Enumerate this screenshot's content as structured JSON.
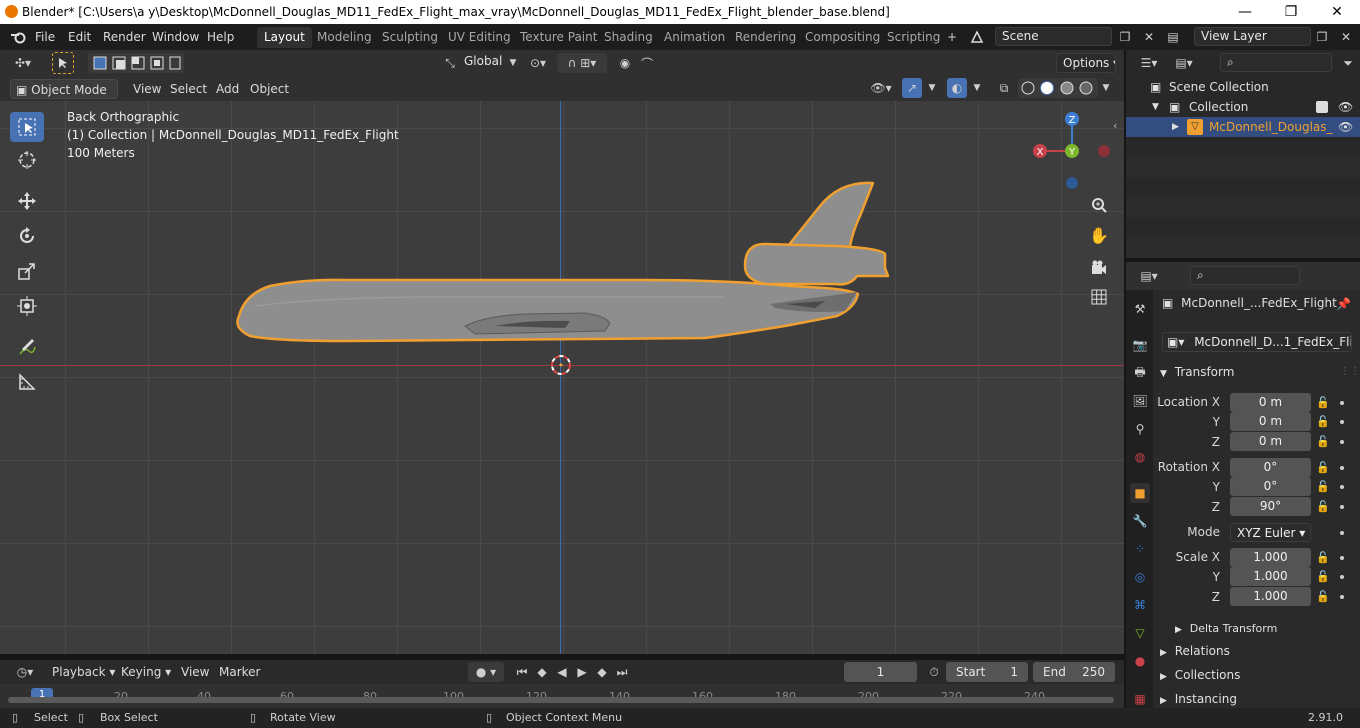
{
  "window": {
    "title": "Blender* [C:\\Users\\a y\\Desktop\\McDonnell_Douglas_MD11_FedEx_Flight_max_vray\\McDonnell_Douglas_MD11_FedEx_Flight_blender_base.blend]",
    "minimize": "—",
    "maximize": "❐",
    "close": "✕"
  },
  "menu": [
    "File",
    "Edit",
    "Render",
    "Window",
    "Help"
  ],
  "workspaces": [
    "Layout",
    "Modeling",
    "Sculpting",
    "UV Editing",
    "Texture Paint",
    "Shading",
    "Animation",
    "Rendering",
    "Compositing",
    "Scripting"
  ],
  "active_workspace": "Layout",
  "scene": {
    "name": "Scene",
    "view_layer": "View Layer"
  },
  "toolbar": {
    "orientation": "Global",
    "options": "Options"
  },
  "viewport_header": {
    "mode": "Object Mode",
    "menus": [
      "View",
      "Select",
      "Add",
      "Object"
    ]
  },
  "viewport": {
    "view_name": "Back Orthographic",
    "collection_info": "(1) Collection | McDonnell_Douglas_MD11_FedEx_Flight",
    "scale": "100 Meters",
    "gizmo": {
      "z": "Z",
      "x": "X",
      "y": "Y"
    }
  },
  "timeline": {
    "menus": [
      "Playback",
      "Keying",
      "View",
      "Marker"
    ],
    "current_frame": "1",
    "start_label": "Start",
    "start": "1",
    "end_label": "End",
    "end": "250",
    "ticks": [
      "1",
      "20",
      "40",
      "60",
      "80",
      "100",
      "120",
      "140",
      "160",
      "180",
      "200",
      "220",
      "240"
    ]
  },
  "status": {
    "select": "Select",
    "box_select": "Box Select",
    "rotate_view": "Rotate View",
    "context_menu": "Object Context Menu",
    "version": "2.91.0"
  },
  "outliner": {
    "scene_collection": "Scene Collection",
    "collection": "Collection",
    "object": "McDonnell_Douglas_"
  },
  "properties": {
    "object_name": "McDonnell_...FedEx_Flight",
    "data_name": "McDonnell_D...1_FedEx_Flight",
    "transform_title": "Transform",
    "location_label": "Location X",
    "rotation_label": "Rotation X",
    "scale_label": "Scale X",
    "y_label": "Y",
    "z_label": "Z",
    "location": [
      "0 m",
      "0 m",
      "0 m"
    ],
    "rotation": [
      "0°",
      "0°",
      "90°"
    ],
    "mode_label": "Mode",
    "mode": "XYZ Euler",
    "scale": [
      "1.000",
      "1.000",
      "1.000"
    ],
    "delta_transform": "Delta Transform",
    "sections": [
      "Relations",
      "Collections",
      "Instancing"
    ]
  },
  "colors": {
    "accent": "#4772b3",
    "selection": "#f0a030",
    "x_axis": "#c8424a",
    "y_axis": "#7cb82a",
    "z_axis": "#3d7fd6"
  }
}
